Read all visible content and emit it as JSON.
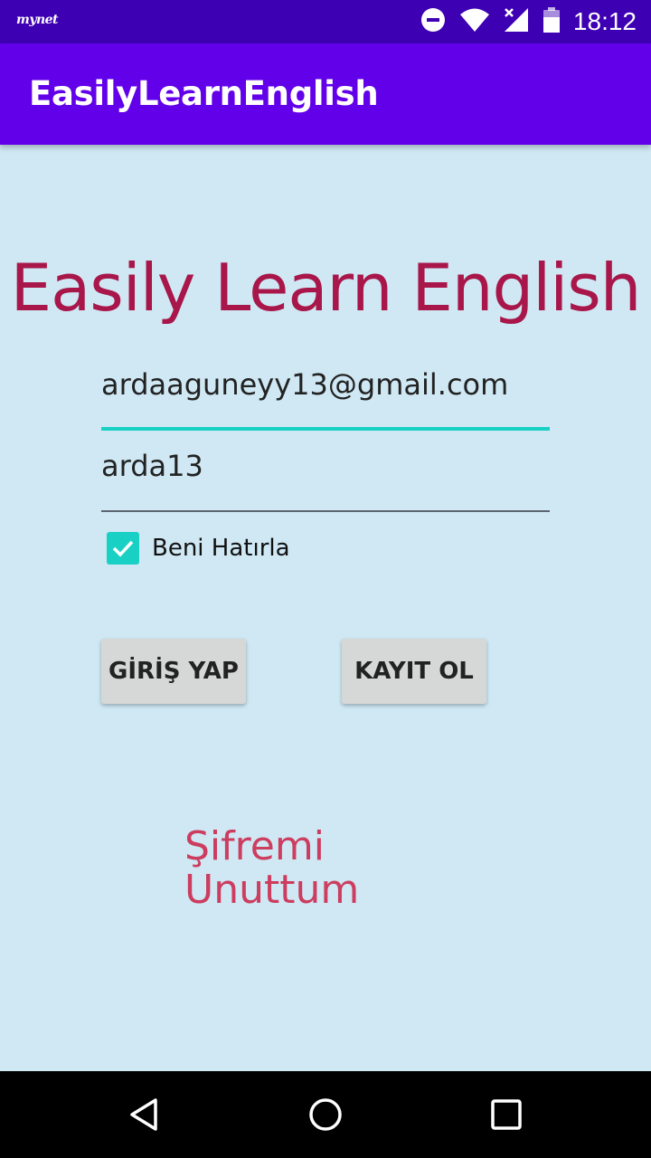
{
  "status_bar": {
    "carrier_logo": "mynet",
    "time": "18:12",
    "icons": [
      "do-not-disturb-icon",
      "wifi-icon",
      "cell-signal-icon",
      "battery-icon"
    ]
  },
  "app_bar": {
    "title": "EasilyLearnEnglish"
  },
  "main": {
    "heading": "Easily Learn English",
    "email_value": "ardaaguneyy13@gmail.com",
    "password_value": "arda13",
    "remember_label": "Beni Hatırla",
    "remember_checked": true,
    "login_label": "GİRİŞ YAP",
    "register_label": "KAYIT OL",
    "forgot_line1": "Şifremi",
    "forgot_line2": "Unuttum"
  },
  "nav_bar": {
    "icons": [
      "back-icon",
      "home-icon",
      "recents-icon"
    ]
  },
  "colors": {
    "status_bar": "#3e00b3",
    "app_bar": "#6200ea",
    "background": "#cfe8f4",
    "heading": "#a8164a",
    "accent": "#18d1c4",
    "forgot_link": "#cc3d5f",
    "button": "#d6d7d7"
  }
}
